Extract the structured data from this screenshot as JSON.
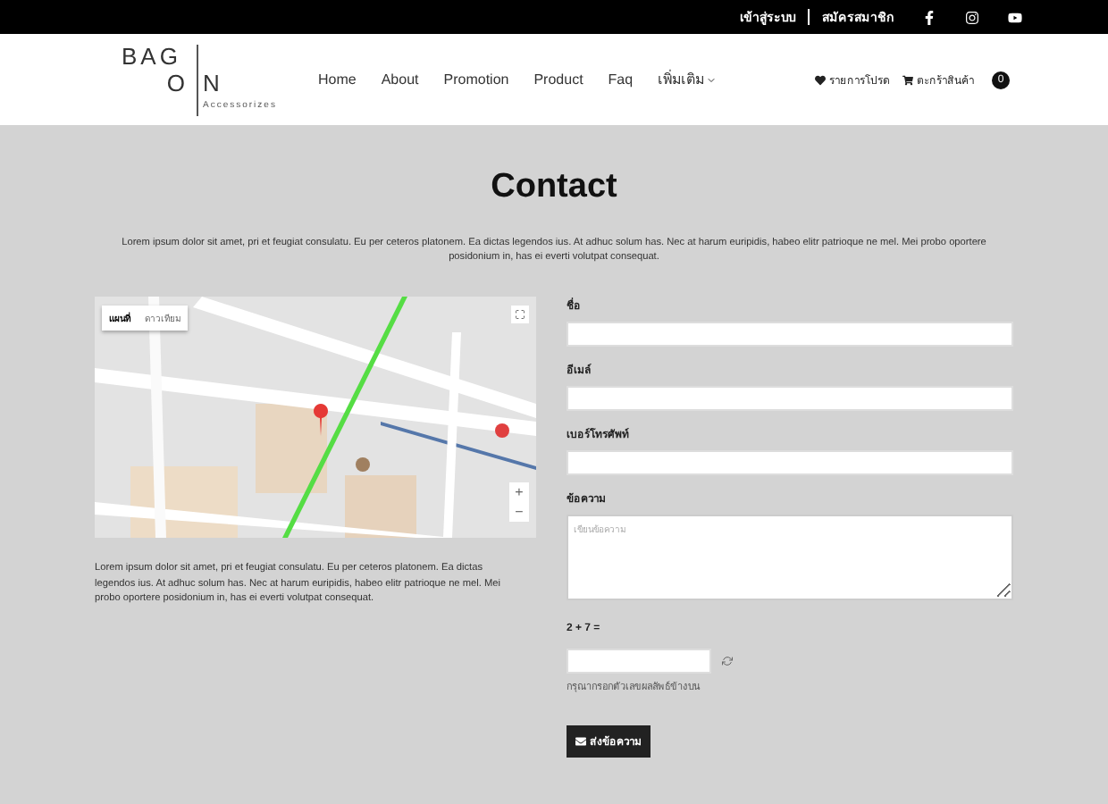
{
  "top_bar": {
    "links": [
      "เข้าสู่ระบบ",
      "สมัครสมาชิก"
    ],
    "social": [
      {
        "kind": "facebook"
      },
      {
        "kind": "instagram"
      },
      {
        "kind": "youtube"
      }
    ]
  },
  "header": {
    "logo": {
      "top": "BAG",
      "left": "O",
      "right": "N",
      "tagline": "Accessorizes"
    },
    "nav": [
      {
        "label": "Home",
        "dropdown": false
      },
      {
        "label": "About",
        "dropdown": false
      },
      {
        "label": "Promotion",
        "dropdown": false
      },
      {
        "label": "Product",
        "dropdown": false
      },
      {
        "label": "Faq",
        "dropdown": false
      },
      {
        "label": "เพิ่มเติม",
        "dropdown": true
      }
    ],
    "wishlist": "รายการโปรด",
    "cart": "ตะกร้าสินค้า",
    "cart_count": "0"
  },
  "page": {
    "title": "Contact",
    "intro": "Lorem ipsum dolor sit amet, pri et feugiat consulatu. Eu per ceteros platonem. Ea dictas legendos ius. At adhuc solum has. Nec at harum euripidis, habeo elitr patrioque ne mel. Mei probo oportere posidonium in, has ei everti volutpat consequat."
  },
  "map": {
    "types": [
      {
        "label": "แผนที่",
        "selected": true
      },
      {
        "label": "ดาวเทียม",
        "selected": false
      }
    ],
    "zoom": [
      "+",
      "−"
    ]
  },
  "address": "Lorem ipsum dolor sit amet, pri et feugiat consulatu. Eu per ceteros platonem. Ea dictas legendos ius. At adhuc solum has. Nec at harum euripidis, habeo elitr patrioque ne mel. Mei probo oportere posidonium in, has ei everti volutpat consequat.",
  "form": {
    "fields": [
      {
        "label": "ชื่อ",
        "kind": "input"
      },
      {
        "label": "อีเมล์",
        "kind": "input"
      },
      {
        "label": "เบอร์โทรศัพท์",
        "kind": "input"
      },
      {
        "label": "ข้อความ",
        "kind": "textarea",
        "placeholder": "เขียนข้อความ"
      }
    ],
    "captcha": {
      "question": "2 + 7 =",
      "hint": "กรุณากรอกตัวเลขผลลัพธ์ข้างบน"
    },
    "submit": "ส่งข้อความ"
  }
}
